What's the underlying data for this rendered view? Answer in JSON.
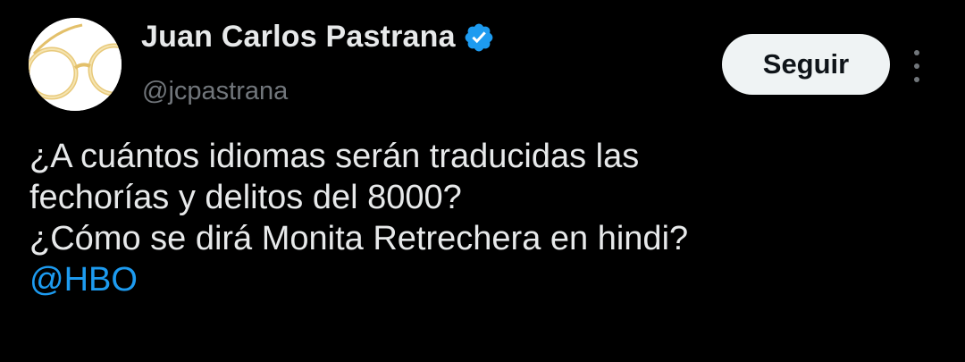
{
  "author": {
    "display_name": "Juan Carlos Pastrana",
    "handle": "@jcpastrana",
    "verified": true,
    "verified_color": "#1d9bf0",
    "avatar_icon": "round-glasses-avatar"
  },
  "actions": {
    "follow_label": "Seguir",
    "more_icon": "vertical-ellipsis-icon"
  },
  "tweet": {
    "lines": [
      "¿A cuántos idiomas serán traducidas las",
      "fechorías y delitos del 8000?",
      "¿Cómo se dirá Monita Retrechera en hindi?"
    ],
    "mention": "@HBO"
  },
  "colors": {
    "background": "#000000",
    "primary_text": "#e7e9ea",
    "secondary_text": "#71767b",
    "link": "#1d9bf0",
    "button_bg": "#eff3f4",
    "button_text": "#0f1419"
  }
}
